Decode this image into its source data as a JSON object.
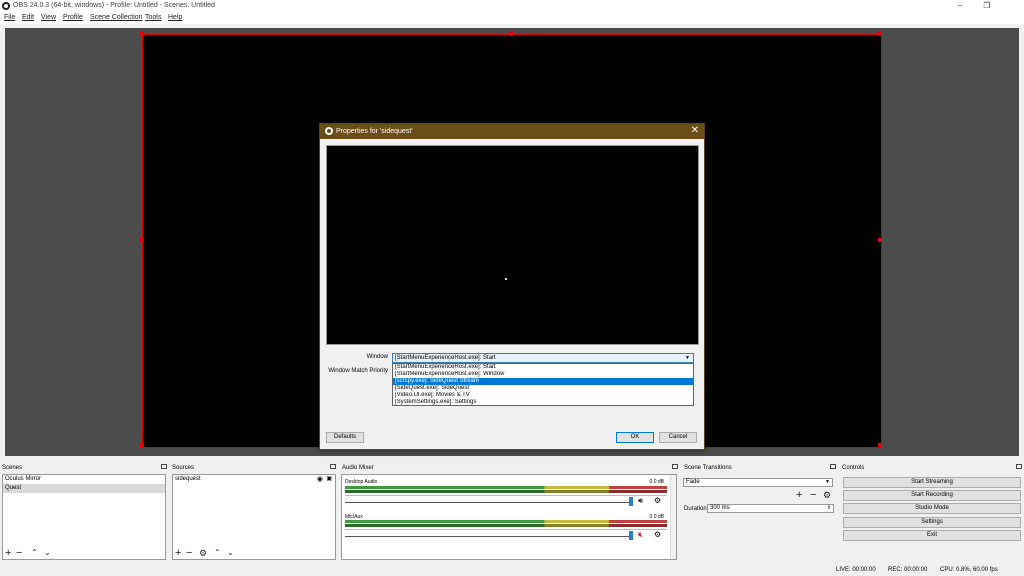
{
  "window": {
    "title": "OBS 24.0.3 (64-bit, windows) - Profile: Untitled - Scenes: Untitled",
    "minimize": "–",
    "maximize": "❐"
  },
  "menu": [
    "File",
    "Edit",
    "View",
    "Profile",
    "Scene Collection",
    "Tools",
    "Help"
  ],
  "dialog": {
    "title": "Properties for 'sidequest'",
    "close": "✕",
    "window_label": "Window",
    "priority_label": "Window Match Priority",
    "window_value": "[StartMenuExperienceHost.exe]: Start",
    "options": [
      "[StartMenuExperienceHost.exe]: Start",
      "[StartMenuExperienceHost.exe]: Window",
      "[scrcpy.exe]: SideQuest Stream",
      "[SideQuest.exe]: SideQuest",
      "[Video.UI.exe]: Movies & TV",
      "[SystemSettings.exe]: Settings"
    ],
    "selected_index": 2,
    "defaults": "Defaults",
    "ok": "OK",
    "cancel": "Cancel"
  },
  "scenes": {
    "title": "Scenes",
    "items": [
      "Oculus Mirror",
      "Quest"
    ],
    "active_index": 1
  },
  "sources": {
    "title": "Sources",
    "items": [
      "sidequest"
    ]
  },
  "mixer": {
    "title": "Audio Mixer",
    "tracks": [
      {
        "name": "Desktop Audio",
        "db": "0.0 dB",
        "muted": false
      },
      {
        "name": "Mic/Aux",
        "db": "0.0 dB",
        "muted": true
      }
    ],
    "scale": [
      "-60",
      "-55",
      "-50",
      "-45",
      "-40",
      "-35",
      "-30",
      "-25",
      "-20",
      "-15",
      "-10",
      "-5",
      "0"
    ]
  },
  "transitions": {
    "title": "Scene Transitions",
    "selected": "Fade",
    "duration_label": "Duration",
    "duration_value": "300 ms"
  },
  "controls": {
    "title": "Controls",
    "buttons": [
      "Start Streaming",
      "Start Recording",
      "Studio Mode",
      "Settings",
      "Exit"
    ]
  },
  "status": {
    "live": "LIVE: 00:00:00",
    "rec": "REC: 00:00:00",
    "cpu": "CPU: 0.8%, 60.00 fps"
  },
  "colors": {
    "dialog_title": "#6b4e17",
    "selection": "#0078d7",
    "canvas_border": "#dd0000"
  }
}
